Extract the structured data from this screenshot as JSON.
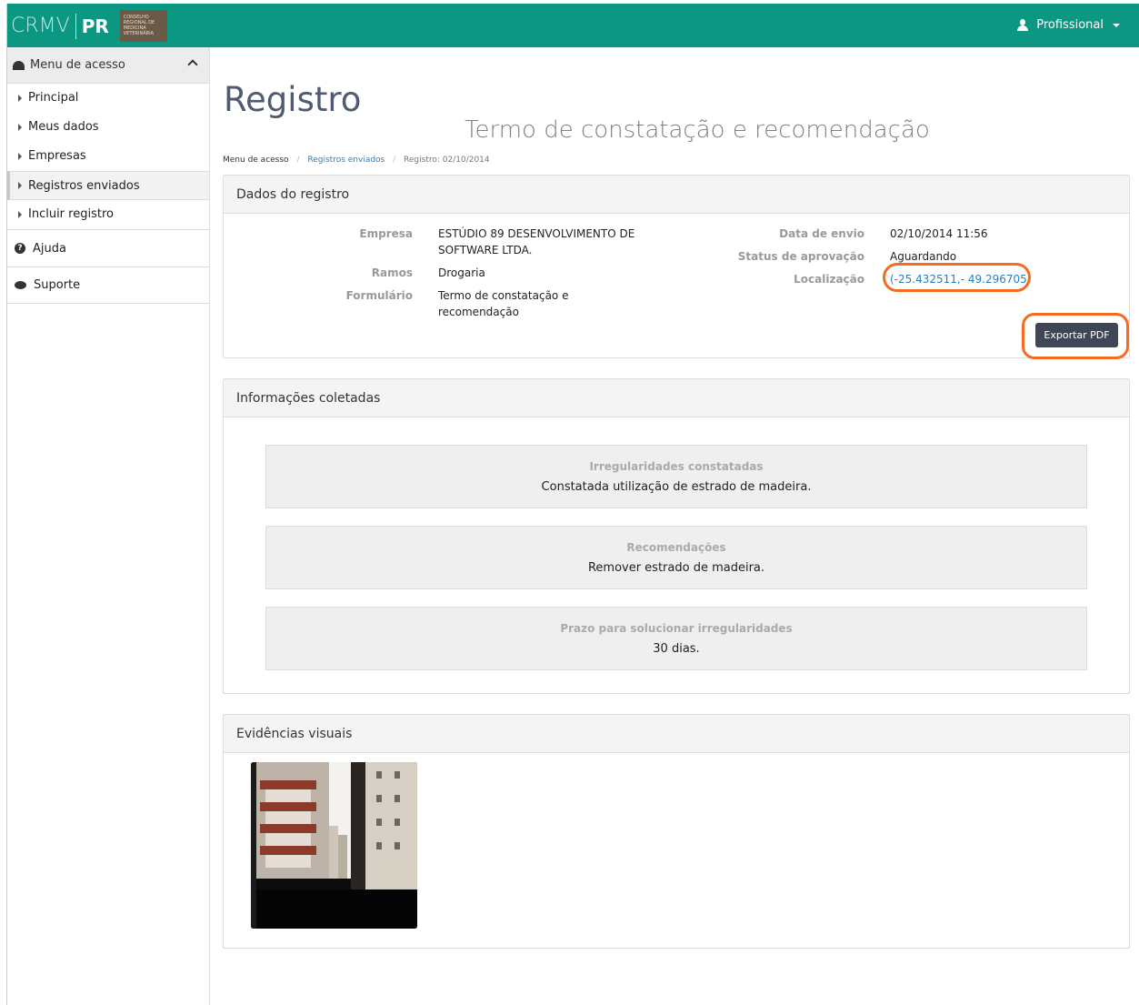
{
  "header": {
    "logo_text": "CRMV",
    "logo_region": "PR",
    "logo_badge": "CONSELHO REGIONAL DE MEDICINA VETERINÁRIA",
    "user_menu_label": "Profissional"
  },
  "sidebar": {
    "heading": "Menu de acesso",
    "items": [
      {
        "label": "Principal"
      },
      {
        "label": "Meus dados"
      },
      {
        "label": "Empresas"
      },
      {
        "label": "Registros enviados"
      },
      {
        "label": "Incluir registro"
      }
    ],
    "help_label": "Ajuda",
    "support_label": "Suporte"
  },
  "page": {
    "title": "Registro",
    "subtitle": "Termo de constatação e recomendação"
  },
  "breadcrumb": {
    "home": "Menu de acesso",
    "section": "Registros enviados",
    "current": "Registro: 02/10/2014",
    "separator": "/"
  },
  "registro": {
    "panel_title": "Dados do registro",
    "empresa_label": "Empresa",
    "empresa_value": "ESTÚDIO 89 DESENVOLVIMENTO DE SOFTWARE LTDA.",
    "ramos_label": "Ramos",
    "ramos_value": "Drogaria",
    "formulario_label": "Formulário",
    "formulario_value": "Termo de constatação e recomendação",
    "data_envio_label": "Data de envio",
    "data_envio_value": "02/10/2014 11:56",
    "status_label": "Status de aprovação",
    "status_value": "Aguardando",
    "localizacao_label": "Localização",
    "localizacao_value": "(-25.432511,- 49.296705)",
    "export_button": "Exportar PDF"
  },
  "informacoes": {
    "panel_title": "Informações coletadas",
    "irregularidades_label": "Irregularidades constatadas",
    "irregularidades_value": "Constatada utilização de estrado de madeira.",
    "recomendacoes_label": "Recomendações",
    "recomendacoes_value": "Remover estrado de madeira.",
    "prazo_label": "Prazo para solucionar irregularidades",
    "prazo_value": "30 dias."
  },
  "evidencias": {
    "panel_title": "Evidências visuais"
  },
  "colors": {
    "topbar": "#0b9782",
    "title": "#4f5b72",
    "highlight": "#f36c22",
    "button": "#3f4757",
    "link": "#2a7fbf"
  }
}
